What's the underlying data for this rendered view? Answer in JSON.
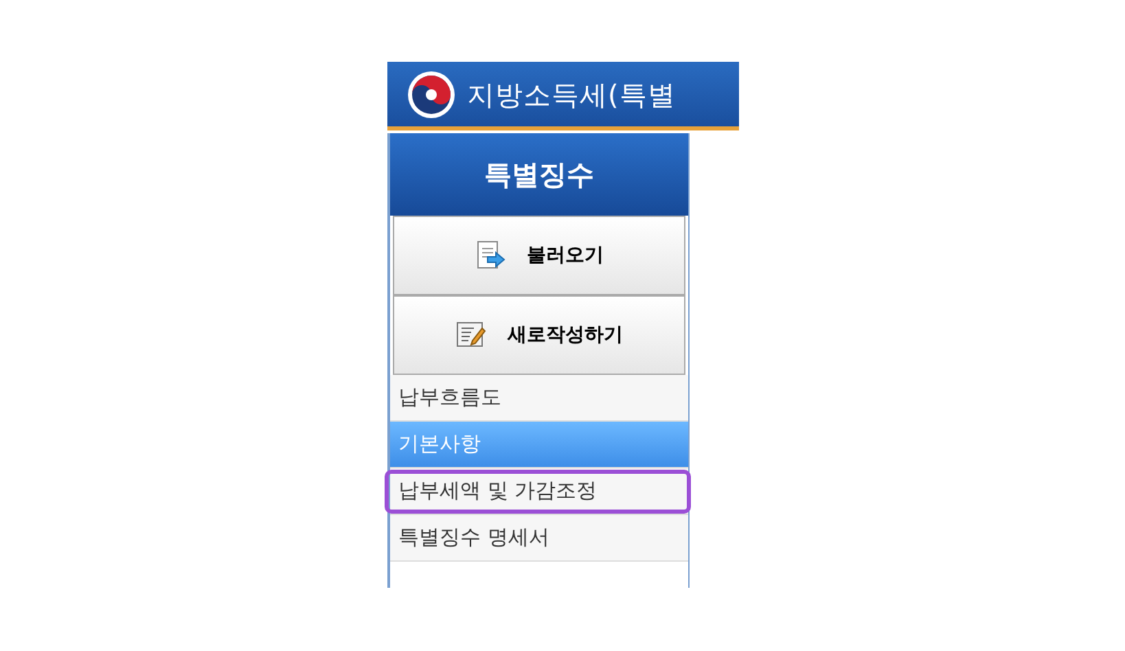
{
  "window": {
    "title": "지방소득세(특별"
  },
  "sidebar": {
    "header": "특별징수",
    "buttons": [
      {
        "label": "불러오기",
        "kind": "load"
      },
      {
        "label": "새로작성하기",
        "kind": "new"
      }
    ],
    "items": [
      {
        "label": "납부흐름도",
        "selected": false,
        "highlighted": false
      },
      {
        "label": "기본사항",
        "selected": true,
        "highlighted": false
      },
      {
        "label": "납부세액 및 가감조정",
        "selected": false,
        "highlighted": true
      },
      {
        "label": "특별징수 명세서",
        "selected": false,
        "highlighted": false
      }
    ]
  }
}
